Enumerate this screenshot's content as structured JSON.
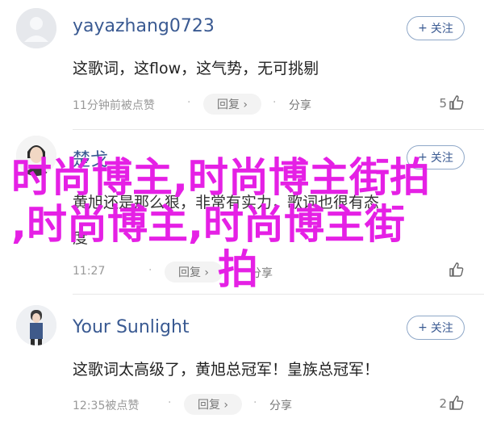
{
  "comments": [
    {
      "username": "yayazhang0723",
      "follow_label": "关注",
      "text": "这歌词，这flow，这气势，无可挑剔",
      "time_label": "11分钟前被点赞",
      "reply_label": "回复 ›",
      "share_label": "分享",
      "like_count": "5"
    },
    {
      "username": "楚戈",
      "follow_label": "关注",
      "text_line1": "黄旭还是那么狠，非常有实力，歌词也很有态",
      "text_line2": "度",
      "time_label": "11:27",
      "reply_label": "回复 ›",
      "share_label": "分享",
      "like_count": ""
    },
    {
      "username": "Your Sunlight",
      "follow_label": "关注",
      "text": "这歌词太高级了，黄旭总冠军！皇族总冠军！",
      "time_label": "12:35被点赞",
      "reply_label": "回复 ›",
      "share_label": "分享",
      "like_count": "2"
    }
  ],
  "overlay": {
    "line1": "时尚博主,时尚博主街拍",
    "line2": ",时尚博主,时尚博主街",
    "line3": "拍",
    "color": "#e520e5"
  },
  "icons": {
    "follow": "plus-icon",
    "like": "thumbs-up-icon",
    "share": "share-icon"
  }
}
